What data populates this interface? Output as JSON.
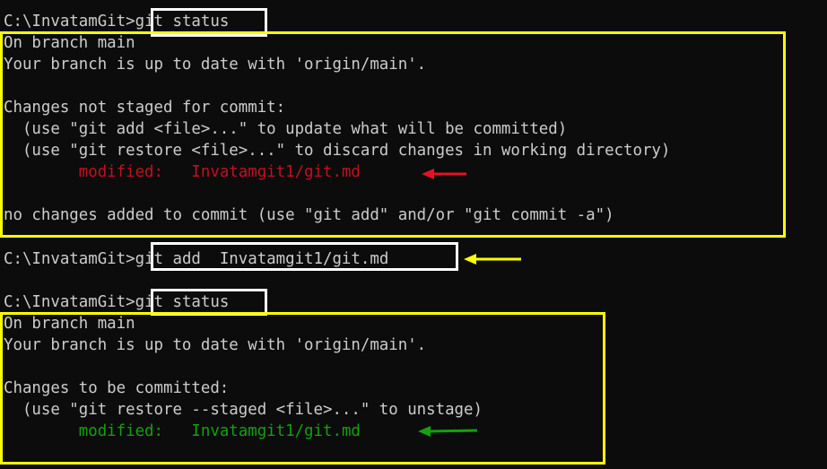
{
  "terminal": {
    "prompt": "C:\\InvatamGit>",
    "block1": {
      "command": "git status",
      "on_branch": "On branch main",
      "up_to_date": "Your branch is up to date with 'origin/main'.",
      "not_staged_header": "Changes not staged for commit:",
      "hint_add": "  (use \"git add <file>...\" to update what will be committed)",
      "hint_restore": "  (use \"git restore <file>...\" to discard changes in working directory)",
      "modified_label": "modified:",
      "modified_file": "Invatamgit1/git.md",
      "no_changes": "no changes added to commit (use \"git add\" and/or \"git commit -a\")"
    },
    "block2": {
      "command": "git add  Invatamgit1/git.md"
    },
    "block3": {
      "command": "git status",
      "on_branch": "On branch main",
      "up_to_date": "Your branch is up to date with 'origin/main'.",
      "staged_header": "Changes to be committed:",
      "hint_unstage": "  (use \"git restore --staged <file>...\" to unstage)",
      "modified_label": "modified:",
      "modified_file": "Invatamgit1/git.md"
    }
  },
  "colors": {
    "background": "#0c0c0c",
    "text": "#cccccc",
    "modified_unstaged": "#c50f1f",
    "modified_staged": "#13a10e",
    "command_box": "#ffffff",
    "output_box": "#ffff00",
    "arrow_red": "#e81123",
    "arrow_yellow": "#ffff00",
    "arrow_green": "#13a10e"
  },
  "icons": [
    "arrow-left-red-icon",
    "arrow-left-yellow-icon",
    "arrow-left-green-icon"
  ]
}
